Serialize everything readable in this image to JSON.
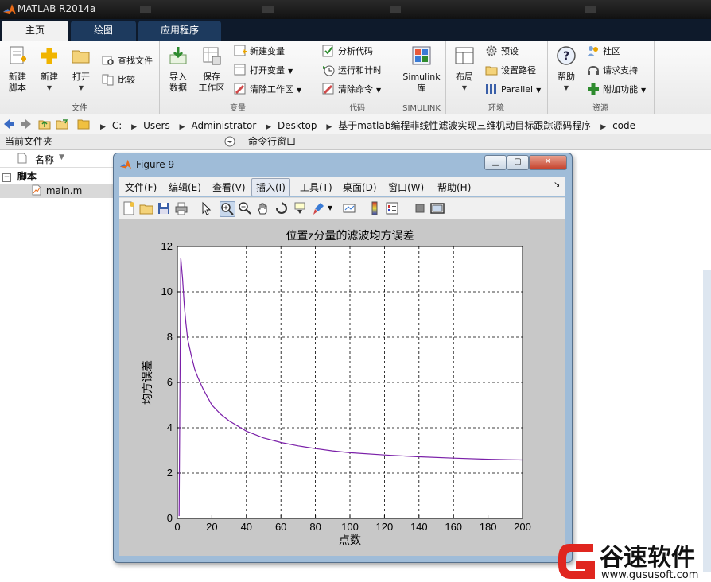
{
  "app": {
    "title": "MATLAB R2014a"
  },
  "tabs": [
    {
      "label": "主页",
      "active": true
    },
    {
      "label": "绘图",
      "active": false
    },
    {
      "label": "应用程序",
      "active": false
    }
  ],
  "ribbon": {
    "file": {
      "group_label": "文件",
      "new_script": "新建\n脚本",
      "new": "新建",
      "open": "打开",
      "find_files": "查找文件",
      "compare": "比较"
    },
    "variable": {
      "group_label": "变量",
      "import": "导入\n数据",
      "save_workspace": "保存\n工作区",
      "new_variable": "新建变量",
      "open_variable": "打开变量",
      "clear_workspace": "清除工作区"
    },
    "code": {
      "group_label": "代码",
      "analyze": "分析代码",
      "run_time": "运行和计时",
      "clear_commands": "清除命令"
    },
    "simulink": {
      "group_label": "SIMULINK",
      "library": "Simulink\n库"
    },
    "environment": {
      "group_label": "环境",
      "layout": "布局",
      "preferences": "预设",
      "set_path": "设置路径",
      "parallel": "Parallel"
    },
    "resources": {
      "group_label": "资源",
      "help": "帮助",
      "community": "社区",
      "request_support": "请求支持",
      "addons": "附加功能"
    }
  },
  "address": {
    "crumbs": [
      "C:",
      "Users",
      "Administrator",
      "Desktop",
      "基于matlab编程非线性滤波实现三维机动目标跟踪源码程序",
      "code"
    ]
  },
  "left_panel": {
    "title": "当前文件夹",
    "column": "名称",
    "folder": "脚本",
    "file": "main.m"
  },
  "command_window": {
    "title": "命令行窗口"
  },
  "figure": {
    "title": "Figure 9",
    "menus": [
      "文件(F)",
      "编辑(E)",
      "查看(V)",
      "插入(I)",
      "工具(T)",
      "桌面(D)",
      "窗口(W)",
      "帮助(H)"
    ],
    "selected_menu": 3
  },
  "chart_data": {
    "type": "line",
    "title": "位置z分量的滤波均方误差",
    "xlabel": "点数",
    "ylabel": "均方误差",
    "xlim": [
      0,
      200
    ],
    "ylim": [
      0,
      12
    ],
    "xticks": [
      0,
      20,
      40,
      60,
      80,
      100,
      120,
      140,
      160,
      180,
      200
    ],
    "yticks": [
      0,
      2,
      4,
      6,
      8,
      10,
      12
    ],
    "grid": true,
    "series": [
      {
        "color": "#7a1fa8",
        "x": [
          1,
          2,
          3,
          4,
          5,
          6,
          8,
          10,
          12,
          15,
          20,
          25,
          30,
          40,
          50,
          60,
          70,
          80,
          90,
          100,
          120,
          140,
          160,
          180,
          200
        ],
        "y": [
          0.1,
          11.5,
          10.6,
          9.4,
          8.6,
          7.9,
          7.2,
          6.6,
          6.2,
          5.7,
          5.0,
          4.6,
          4.3,
          3.85,
          3.55,
          3.35,
          3.2,
          3.08,
          2.98,
          2.9,
          2.8,
          2.72,
          2.66,
          2.61,
          2.58
        ]
      }
    ]
  },
  "watermark": {
    "name": "谷速软件",
    "url": "www.gususoft.com"
  }
}
